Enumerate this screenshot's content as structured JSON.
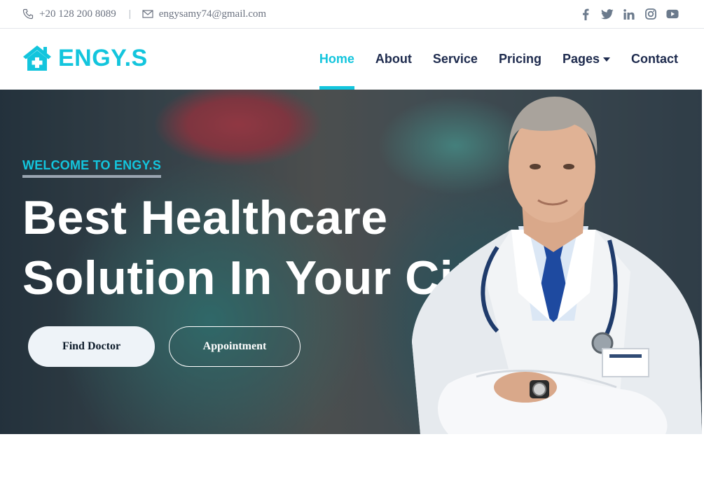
{
  "topbar": {
    "phone": "+20 128 200 8089",
    "separator": "|",
    "email": "engysamy74@gmail.com",
    "social_icons": [
      "facebook-icon",
      "twitter-icon",
      "linkedin-icon",
      "instagram-icon",
      "youtube-icon"
    ]
  },
  "brand": {
    "name": "ENGY.S",
    "logo_icon": "hospital-house-icon"
  },
  "nav": {
    "items": [
      {
        "label": "Home",
        "active": true
      },
      {
        "label": "About",
        "active": false
      },
      {
        "label": "Service",
        "active": false
      },
      {
        "label": "Pricing",
        "active": false
      },
      {
        "label": "Pages",
        "active": false,
        "dropdown": true
      },
      {
        "label": "Contact",
        "active": false
      }
    ]
  },
  "hero": {
    "welcome": "WELCOME TO ENGY.S",
    "headline_line1": "Best Healthcare",
    "headline_line2": "Solution In Your City",
    "primary_button": "Find Doctor",
    "secondary_button": "Appointment"
  },
  "colors": {
    "accent": "#13c5dd",
    "navy": "#1d2a4d",
    "text_muted": "#6b7280"
  }
}
